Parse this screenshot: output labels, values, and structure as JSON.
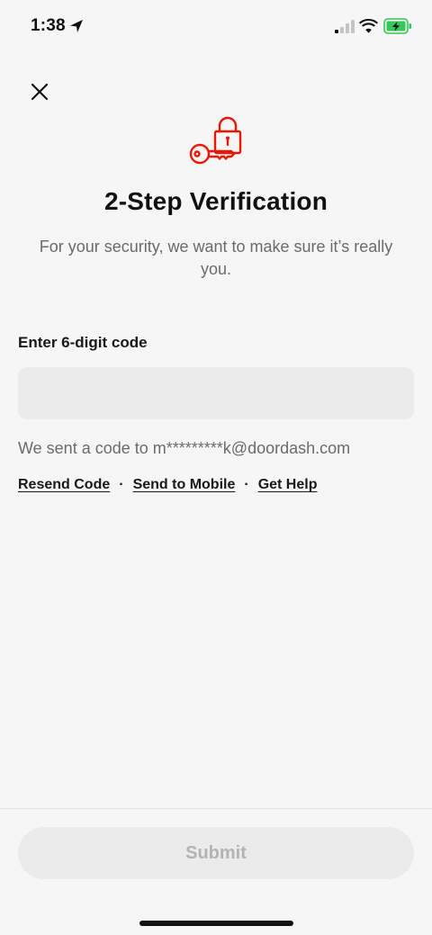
{
  "status_bar": {
    "time": "1:38",
    "location_icon": "location-arrow-icon",
    "signal_icon": "cellular-signal-icon",
    "wifi_icon": "wifi-icon",
    "battery_icon": "battery-charging-icon",
    "battery_color": "#34c759"
  },
  "header": {
    "close_icon": "close-icon"
  },
  "hero": {
    "icon": "lock-key-icon",
    "icon_color": "#eb1700",
    "title": "2-Step Verification",
    "subtitle": "For your security, we want to make sure it’s really you."
  },
  "form": {
    "code_label": "Enter 6-digit code",
    "code_value": "",
    "code_placeholder": "",
    "sent_message": "We sent a code to m*********k@doordash.com",
    "links": {
      "resend": "Resend Code",
      "separator": "·",
      "send_to_mobile": "Send to Mobile",
      "get_help": "Get Help"
    }
  },
  "footer": {
    "submit_label": "Submit",
    "submit_enabled": false
  }
}
